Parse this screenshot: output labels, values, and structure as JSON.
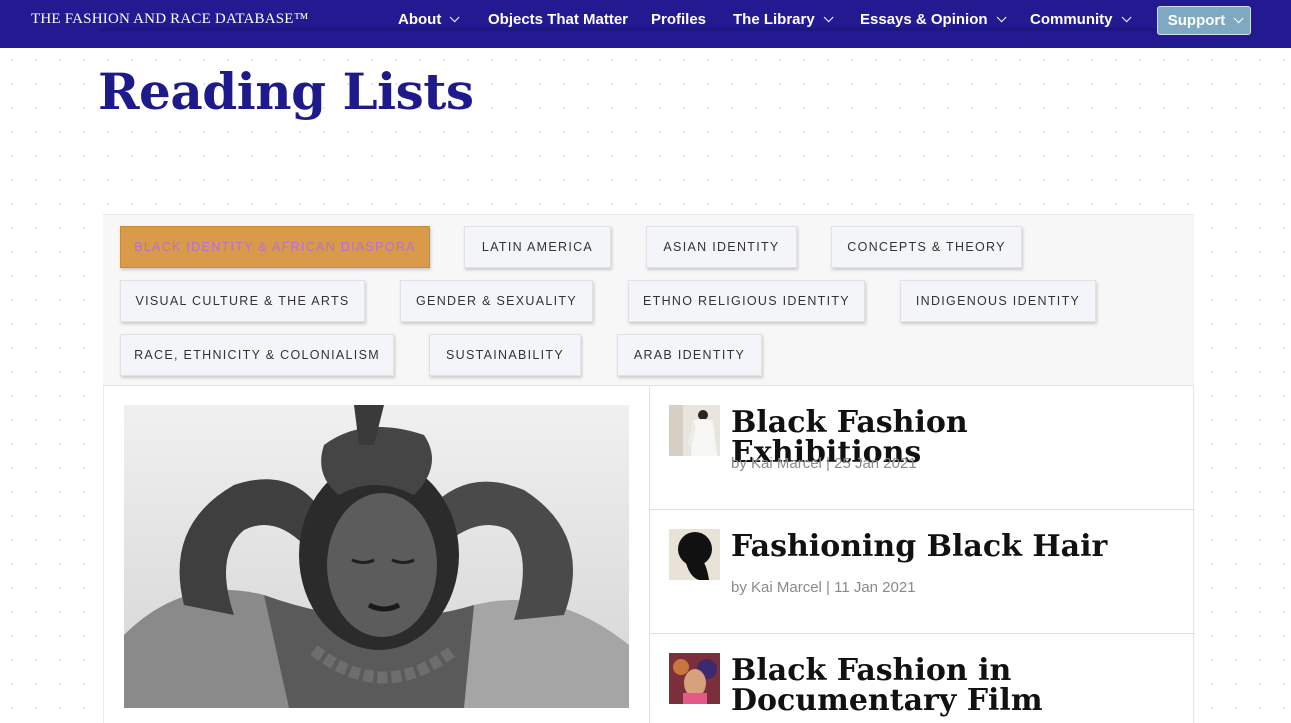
{
  "nav": {
    "brand": "THE FASHION AND RACE DATABASE™",
    "items": [
      {
        "label": "About",
        "dropdown": true
      },
      {
        "label": "Objects That Matter",
        "dropdown": false
      },
      {
        "label": "Profiles",
        "dropdown": false
      },
      {
        "label": "The Library",
        "dropdown": true
      },
      {
        "label": "Essays & Opinion",
        "dropdown": true
      },
      {
        "label": "Community",
        "dropdown": true
      }
    ],
    "support_label": "Support"
  },
  "page": {
    "title": "Reading Lists"
  },
  "filters": [
    {
      "label": "BLACK IDENTITY & AFRICAN DIASPORA",
      "active": true
    },
    {
      "label": "LATIN AMERICA",
      "active": false
    },
    {
      "label": "ASIAN IDENTITY",
      "active": false
    },
    {
      "label": "CONCEPTS & THEORY",
      "active": false
    },
    {
      "label": "VISUAL CULTURE & THE ARTS",
      "active": false
    },
    {
      "label": "GENDER & SEXUALITY",
      "active": false
    },
    {
      "label": "ETHNO RELIGIOUS IDENTITY",
      "active": false
    },
    {
      "label": "INDIGENOUS IDENTITY",
      "active": false
    },
    {
      "label": "RACE, ETHNICITY & COLONIALISM",
      "active": false
    },
    {
      "label": "SUSTAINABILITY",
      "active": false
    },
    {
      "label": "ARAB IDENTITY",
      "active": false
    }
  ],
  "articles": [
    {
      "title": "Black Fashion Exhibitions",
      "meta": "by Kai Marcel |  25 Jan 2021"
    },
    {
      "title": "Fashioning Black Hair",
      "meta": "by Kai Marcel |  11 Jan 2021"
    },
    {
      "title": "Black Fashion in Documentary Film",
      "meta": ""
    }
  ],
  "colors": {
    "nav_bg": "#231a91",
    "title": "#1f1a8c",
    "active_chip_bg": "#d99a49",
    "active_chip_text": "#b76fd6",
    "support_bg": "#7fa9c3"
  }
}
